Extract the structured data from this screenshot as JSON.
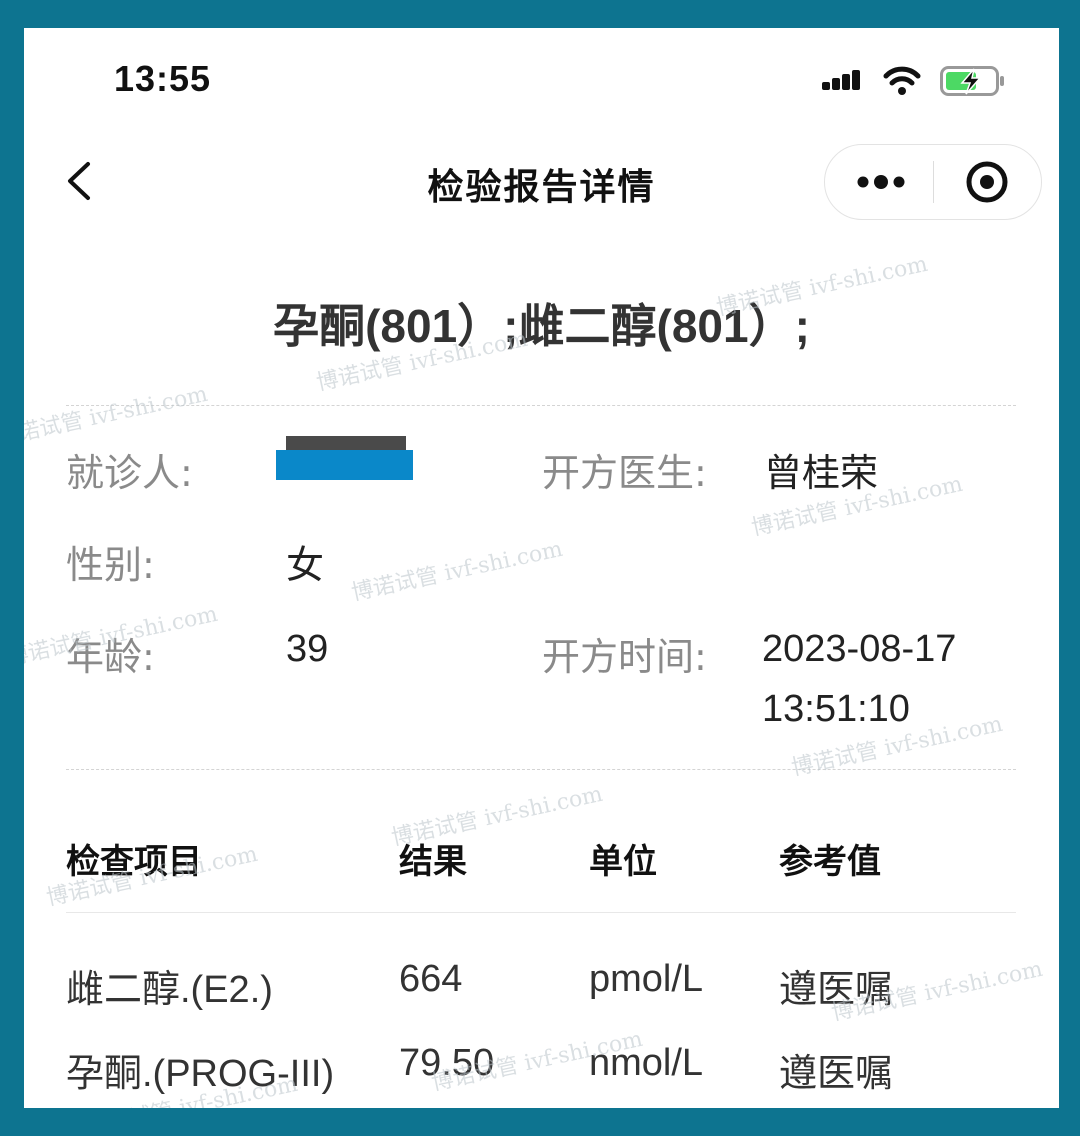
{
  "status_bar": {
    "time": "13:55"
  },
  "nav": {
    "title": "检验报告详情"
  },
  "report": {
    "title": "孕酮(801）;雌二醇(801）;"
  },
  "info": {
    "patient_label": "就诊人:",
    "doctor_label": "开方医生:",
    "doctor_value": "曾桂荣",
    "gender_label": "性别:",
    "gender_value": "女",
    "age_label": "年龄:",
    "age_value": "39",
    "time_label": "开方时间:",
    "time_date": "2023-08-17",
    "time_clock": "13:51:10"
  },
  "table": {
    "headers": [
      "检查项目",
      "结果",
      "单位",
      "参考值"
    ],
    "rows": [
      {
        "item": "雌二醇.(E2.)",
        "result": "664",
        "unit": "pmol/L",
        "reference": "遵医嘱"
      },
      {
        "item": "孕酮.(PROG-III)",
        "result": "79.50",
        "unit": "nmol/L",
        "reference": "遵医嘱"
      }
    ]
  },
  "watermark": "博诺试管 ivf-shi.com",
  "colors": {
    "frame": "#0d7490",
    "redaction": "#0a88c9"
  }
}
